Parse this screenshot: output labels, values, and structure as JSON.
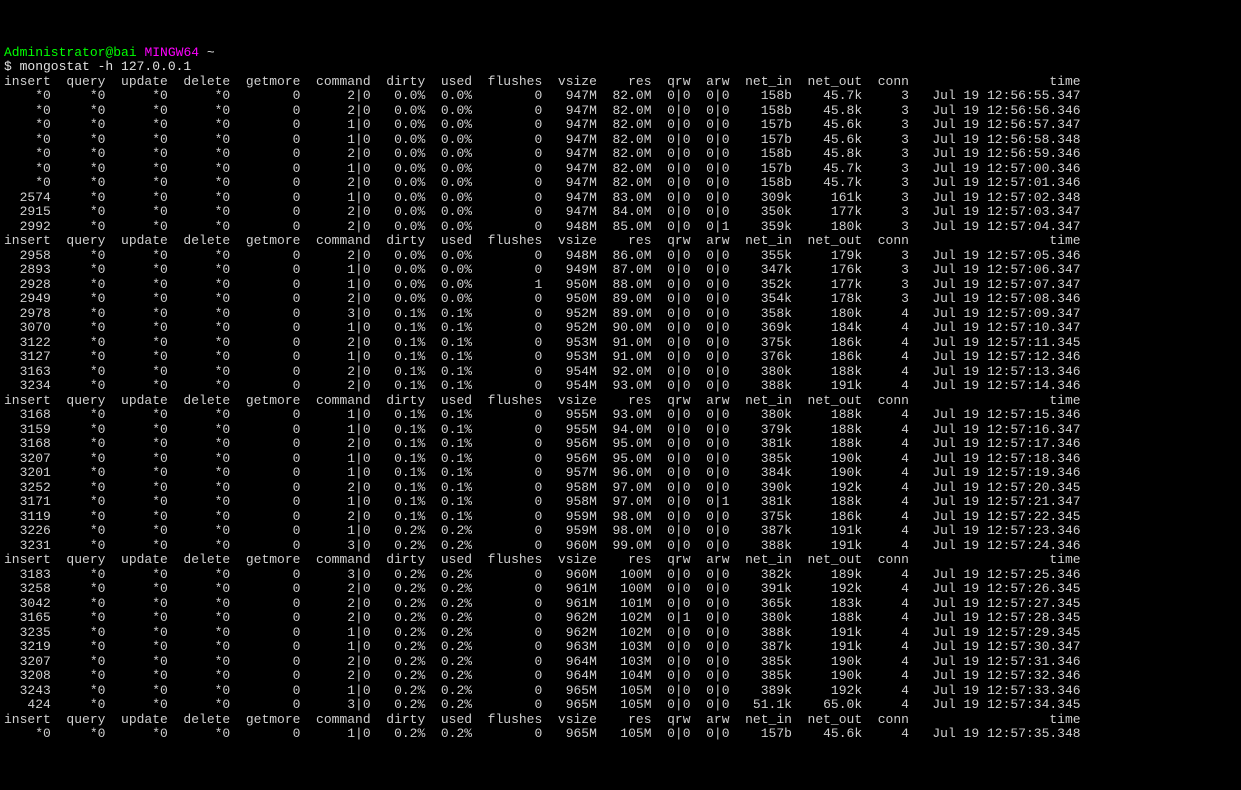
{
  "prompt": {
    "user": "Administrator@bai",
    "sys": "MINGW64",
    "path": "~"
  },
  "command": "$ mongostat -h 127.0.0.1",
  "headers": [
    "insert",
    "query",
    "update",
    "delete",
    "getmore",
    "command",
    "dirty",
    "used",
    "flushes",
    "vsize",
    "res",
    "qrw",
    "arw",
    "net_in",
    "net_out",
    "conn",
    "time"
  ],
  "cw": {
    "insert": 6,
    "query": 6,
    "update": 7,
    "delete": 7,
    "getmore": 8,
    "command": 8,
    "dirty": 6,
    "used": 5,
    "flushes": 8,
    "vsize": 6,
    "res": 6,
    "qrw": 4,
    "arw": 4,
    "net_in": 7,
    "net_out": 8,
    "conn": 5,
    "time": 21
  },
  "blocks": [
    [
      {
        "insert": "*0",
        "query": "*0",
        "update": "*0",
        "delete": "*0",
        "getmore": "0",
        "command": "2|0",
        "dirty": "0.0%",
        "used": "0.0%",
        "flushes": "0",
        "vsize": "947M",
        "res": "82.0M",
        "qrw": "0|0",
        "arw": "0|0",
        "net_in": "158b",
        "net_out": "45.7k",
        "conn": "3",
        "time": "Jul 19 12:56:55.347"
      },
      {
        "insert": "*0",
        "query": "*0",
        "update": "*0",
        "delete": "*0",
        "getmore": "0",
        "command": "2|0",
        "dirty": "0.0%",
        "used": "0.0%",
        "flushes": "0",
        "vsize": "947M",
        "res": "82.0M",
        "qrw": "0|0",
        "arw": "0|0",
        "net_in": "158b",
        "net_out": "45.8k",
        "conn": "3",
        "time": "Jul 19 12:56:56.346"
      },
      {
        "insert": "*0",
        "query": "*0",
        "update": "*0",
        "delete": "*0",
        "getmore": "0",
        "command": "1|0",
        "dirty": "0.0%",
        "used": "0.0%",
        "flushes": "0",
        "vsize": "947M",
        "res": "82.0M",
        "qrw": "0|0",
        "arw": "0|0",
        "net_in": "157b",
        "net_out": "45.6k",
        "conn": "3",
        "time": "Jul 19 12:56:57.347"
      },
      {
        "insert": "*0",
        "query": "*0",
        "update": "*0",
        "delete": "*0",
        "getmore": "0",
        "command": "1|0",
        "dirty": "0.0%",
        "used": "0.0%",
        "flushes": "0",
        "vsize": "947M",
        "res": "82.0M",
        "qrw": "0|0",
        "arw": "0|0",
        "net_in": "157b",
        "net_out": "45.6k",
        "conn": "3",
        "time": "Jul 19 12:56:58.348"
      },
      {
        "insert": "*0",
        "query": "*0",
        "update": "*0",
        "delete": "*0",
        "getmore": "0",
        "command": "2|0",
        "dirty": "0.0%",
        "used": "0.0%",
        "flushes": "0",
        "vsize": "947M",
        "res": "82.0M",
        "qrw": "0|0",
        "arw": "0|0",
        "net_in": "158b",
        "net_out": "45.8k",
        "conn": "3",
        "time": "Jul 19 12:56:59.346"
      },
      {
        "insert": "*0",
        "query": "*0",
        "update": "*0",
        "delete": "*0",
        "getmore": "0",
        "command": "1|0",
        "dirty": "0.0%",
        "used": "0.0%",
        "flushes": "0",
        "vsize": "947M",
        "res": "82.0M",
        "qrw": "0|0",
        "arw": "0|0",
        "net_in": "157b",
        "net_out": "45.7k",
        "conn": "3",
        "time": "Jul 19 12:57:00.346"
      },
      {
        "insert": "*0",
        "query": "*0",
        "update": "*0",
        "delete": "*0",
        "getmore": "0",
        "command": "2|0",
        "dirty": "0.0%",
        "used": "0.0%",
        "flushes": "0",
        "vsize": "947M",
        "res": "82.0M",
        "qrw": "0|0",
        "arw": "0|0",
        "net_in": "158b",
        "net_out": "45.7k",
        "conn": "3",
        "time": "Jul 19 12:57:01.346"
      },
      {
        "insert": "2574",
        "query": "*0",
        "update": "*0",
        "delete": "*0",
        "getmore": "0",
        "command": "1|0",
        "dirty": "0.0%",
        "used": "0.0%",
        "flushes": "0",
        "vsize": "947M",
        "res": "83.0M",
        "qrw": "0|0",
        "arw": "0|0",
        "net_in": "309k",
        "net_out": "161k",
        "conn": "3",
        "time": "Jul 19 12:57:02.348"
      },
      {
        "insert": "2915",
        "query": "*0",
        "update": "*0",
        "delete": "*0",
        "getmore": "0",
        "command": "2|0",
        "dirty": "0.0%",
        "used": "0.0%",
        "flushes": "0",
        "vsize": "947M",
        "res": "84.0M",
        "qrw": "0|0",
        "arw": "0|0",
        "net_in": "350k",
        "net_out": "177k",
        "conn": "3",
        "time": "Jul 19 12:57:03.347"
      },
      {
        "insert": "2992",
        "query": "*0",
        "update": "*0",
        "delete": "*0",
        "getmore": "0",
        "command": "2|0",
        "dirty": "0.0%",
        "used": "0.0%",
        "flushes": "0",
        "vsize": "948M",
        "res": "85.0M",
        "qrw": "0|0",
        "arw": "0|1",
        "net_in": "359k",
        "net_out": "180k",
        "conn": "3",
        "time": "Jul 19 12:57:04.347"
      }
    ],
    [
      {
        "insert": "2958",
        "query": "*0",
        "update": "*0",
        "delete": "*0",
        "getmore": "0",
        "command": "2|0",
        "dirty": "0.0%",
        "used": "0.0%",
        "flushes": "0",
        "vsize": "948M",
        "res": "86.0M",
        "qrw": "0|0",
        "arw": "0|0",
        "net_in": "355k",
        "net_out": "179k",
        "conn": "3",
        "time": "Jul 19 12:57:05.346"
      },
      {
        "insert": "2893",
        "query": "*0",
        "update": "*0",
        "delete": "*0",
        "getmore": "0",
        "command": "1|0",
        "dirty": "0.0%",
        "used": "0.0%",
        "flushes": "0",
        "vsize": "949M",
        "res": "87.0M",
        "qrw": "0|0",
        "arw": "0|0",
        "net_in": "347k",
        "net_out": "176k",
        "conn": "3",
        "time": "Jul 19 12:57:06.347"
      },
      {
        "insert": "2928",
        "query": "*0",
        "update": "*0",
        "delete": "*0",
        "getmore": "0",
        "command": "1|0",
        "dirty": "0.0%",
        "used": "0.0%",
        "flushes": "1",
        "vsize": "950M",
        "res": "88.0M",
        "qrw": "0|0",
        "arw": "0|0",
        "net_in": "352k",
        "net_out": "177k",
        "conn": "3",
        "time": "Jul 19 12:57:07.347"
      },
      {
        "insert": "2949",
        "query": "*0",
        "update": "*0",
        "delete": "*0",
        "getmore": "0",
        "command": "2|0",
        "dirty": "0.0%",
        "used": "0.0%",
        "flushes": "0",
        "vsize": "950M",
        "res": "89.0M",
        "qrw": "0|0",
        "arw": "0|0",
        "net_in": "354k",
        "net_out": "178k",
        "conn": "3",
        "time": "Jul 19 12:57:08.346"
      },
      {
        "insert": "2978",
        "query": "*0",
        "update": "*0",
        "delete": "*0",
        "getmore": "0",
        "command": "3|0",
        "dirty": "0.1%",
        "used": "0.1%",
        "flushes": "0",
        "vsize": "952M",
        "res": "89.0M",
        "qrw": "0|0",
        "arw": "0|0",
        "net_in": "358k",
        "net_out": "180k",
        "conn": "4",
        "time": "Jul 19 12:57:09.347"
      },
      {
        "insert": "3070",
        "query": "*0",
        "update": "*0",
        "delete": "*0",
        "getmore": "0",
        "command": "1|0",
        "dirty": "0.1%",
        "used": "0.1%",
        "flushes": "0",
        "vsize": "952M",
        "res": "90.0M",
        "qrw": "0|0",
        "arw": "0|0",
        "net_in": "369k",
        "net_out": "184k",
        "conn": "4",
        "time": "Jul 19 12:57:10.347"
      },
      {
        "insert": "3122",
        "query": "*0",
        "update": "*0",
        "delete": "*0",
        "getmore": "0",
        "command": "2|0",
        "dirty": "0.1%",
        "used": "0.1%",
        "flushes": "0",
        "vsize": "953M",
        "res": "91.0M",
        "qrw": "0|0",
        "arw": "0|0",
        "net_in": "375k",
        "net_out": "186k",
        "conn": "4",
        "time": "Jul 19 12:57:11.345"
      },
      {
        "insert": "3127",
        "query": "*0",
        "update": "*0",
        "delete": "*0",
        "getmore": "0",
        "command": "1|0",
        "dirty": "0.1%",
        "used": "0.1%",
        "flushes": "0",
        "vsize": "953M",
        "res": "91.0M",
        "qrw": "0|0",
        "arw": "0|0",
        "net_in": "376k",
        "net_out": "186k",
        "conn": "4",
        "time": "Jul 19 12:57:12.346"
      },
      {
        "insert": "3163",
        "query": "*0",
        "update": "*0",
        "delete": "*0",
        "getmore": "0",
        "command": "2|0",
        "dirty": "0.1%",
        "used": "0.1%",
        "flushes": "0",
        "vsize": "954M",
        "res": "92.0M",
        "qrw": "0|0",
        "arw": "0|0",
        "net_in": "380k",
        "net_out": "188k",
        "conn": "4",
        "time": "Jul 19 12:57:13.346"
      },
      {
        "insert": "3234",
        "query": "*0",
        "update": "*0",
        "delete": "*0",
        "getmore": "0",
        "command": "2|0",
        "dirty": "0.1%",
        "used": "0.1%",
        "flushes": "0",
        "vsize": "954M",
        "res": "93.0M",
        "qrw": "0|0",
        "arw": "0|0",
        "net_in": "388k",
        "net_out": "191k",
        "conn": "4",
        "time": "Jul 19 12:57:14.346"
      }
    ],
    [
      {
        "insert": "3168",
        "query": "*0",
        "update": "*0",
        "delete": "*0",
        "getmore": "0",
        "command": "1|0",
        "dirty": "0.1%",
        "used": "0.1%",
        "flushes": "0",
        "vsize": "955M",
        "res": "93.0M",
        "qrw": "0|0",
        "arw": "0|0",
        "net_in": "380k",
        "net_out": "188k",
        "conn": "4",
        "time": "Jul 19 12:57:15.346"
      },
      {
        "insert": "3159",
        "query": "*0",
        "update": "*0",
        "delete": "*0",
        "getmore": "0",
        "command": "1|0",
        "dirty": "0.1%",
        "used": "0.1%",
        "flushes": "0",
        "vsize": "955M",
        "res": "94.0M",
        "qrw": "0|0",
        "arw": "0|0",
        "net_in": "379k",
        "net_out": "188k",
        "conn": "4",
        "time": "Jul 19 12:57:16.347"
      },
      {
        "insert": "3168",
        "query": "*0",
        "update": "*0",
        "delete": "*0",
        "getmore": "0",
        "command": "2|0",
        "dirty": "0.1%",
        "used": "0.1%",
        "flushes": "0",
        "vsize": "956M",
        "res": "95.0M",
        "qrw": "0|0",
        "arw": "0|0",
        "net_in": "381k",
        "net_out": "188k",
        "conn": "4",
        "time": "Jul 19 12:57:17.346"
      },
      {
        "insert": "3207",
        "query": "*0",
        "update": "*0",
        "delete": "*0",
        "getmore": "0",
        "command": "1|0",
        "dirty": "0.1%",
        "used": "0.1%",
        "flushes": "0",
        "vsize": "956M",
        "res": "95.0M",
        "qrw": "0|0",
        "arw": "0|0",
        "net_in": "385k",
        "net_out": "190k",
        "conn": "4",
        "time": "Jul 19 12:57:18.346"
      },
      {
        "insert": "3201",
        "query": "*0",
        "update": "*0",
        "delete": "*0",
        "getmore": "0",
        "command": "1|0",
        "dirty": "0.1%",
        "used": "0.1%",
        "flushes": "0",
        "vsize": "957M",
        "res": "96.0M",
        "qrw": "0|0",
        "arw": "0|0",
        "net_in": "384k",
        "net_out": "190k",
        "conn": "4",
        "time": "Jul 19 12:57:19.346"
      },
      {
        "insert": "3252",
        "query": "*0",
        "update": "*0",
        "delete": "*0",
        "getmore": "0",
        "command": "2|0",
        "dirty": "0.1%",
        "used": "0.1%",
        "flushes": "0",
        "vsize": "958M",
        "res": "97.0M",
        "qrw": "0|0",
        "arw": "0|0",
        "net_in": "390k",
        "net_out": "192k",
        "conn": "4",
        "time": "Jul 19 12:57:20.345"
      },
      {
        "insert": "3171",
        "query": "*0",
        "update": "*0",
        "delete": "*0",
        "getmore": "0",
        "command": "1|0",
        "dirty": "0.1%",
        "used": "0.1%",
        "flushes": "0",
        "vsize": "958M",
        "res": "97.0M",
        "qrw": "0|0",
        "arw": "0|1",
        "net_in": "381k",
        "net_out": "188k",
        "conn": "4",
        "time": "Jul 19 12:57:21.347"
      },
      {
        "insert": "3119",
        "query": "*0",
        "update": "*0",
        "delete": "*0",
        "getmore": "0",
        "command": "2|0",
        "dirty": "0.1%",
        "used": "0.1%",
        "flushes": "0",
        "vsize": "959M",
        "res": "98.0M",
        "qrw": "0|0",
        "arw": "0|0",
        "net_in": "375k",
        "net_out": "186k",
        "conn": "4",
        "time": "Jul 19 12:57:22.345"
      },
      {
        "insert": "3226",
        "query": "*0",
        "update": "*0",
        "delete": "*0",
        "getmore": "0",
        "command": "1|0",
        "dirty": "0.2%",
        "used": "0.2%",
        "flushes": "0",
        "vsize": "959M",
        "res": "98.0M",
        "qrw": "0|0",
        "arw": "0|0",
        "net_in": "387k",
        "net_out": "191k",
        "conn": "4",
        "time": "Jul 19 12:57:23.346"
      },
      {
        "insert": "3231",
        "query": "*0",
        "update": "*0",
        "delete": "*0",
        "getmore": "0",
        "command": "3|0",
        "dirty": "0.2%",
        "used": "0.2%",
        "flushes": "0",
        "vsize": "960M",
        "res": "99.0M",
        "qrw": "0|0",
        "arw": "0|0",
        "net_in": "388k",
        "net_out": "191k",
        "conn": "4",
        "time": "Jul 19 12:57:24.346"
      }
    ],
    [
      {
        "insert": "3183",
        "query": "*0",
        "update": "*0",
        "delete": "*0",
        "getmore": "0",
        "command": "3|0",
        "dirty": "0.2%",
        "used": "0.2%",
        "flushes": "0",
        "vsize": "960M",
        "res": "100M",
        "qrw": "0|0",
        "arw": "0|0",
        "net_in": "382k",
        "net_out": "189k",
        "conn": "4",
        "time": "Jul 19 12:57:25.346"
      },
      {
        "insert": "3258",
        "query": "*0",
        "update": "*0",
        "delete": "*0",
        "getmore": "0",
        "command": "2|0",
        "dirty": "0.2%",
        "used": "0.2%",
        "flushes": "0",
        "vsize": "961M",
        "res": "100M",
        "qrw": "0|0",
        "arw": "0|0",
        "net_in": "391k",
        "net_out": "192k",
        "conn": "4",
        "time": "Jul 19 12:57:26.345"
      },
      {
        "insert": "3042",
        "query": "*0",
        "update": "*0",
        "delete": "*0",
        "getmore": "0",
        "command": "2|0",
        "dirty": "0.2%",
        "used": "0.2%",
        "flushes": "0",
        "vsize": "961M",
        "res": "101M",
        "qrw": "0|0",
        "arw": "0|0",
        "net_in": "365k",
        "net_out": "183k",
        "conn": "4",
        "time": "Jul 19 12:57:27.345"
      },
      {
        "insert": "3165",
        "query": "*0",
        "update": "*0",
        "delete": "*0",
        "getmore": "0",
        "command": "2|0",
        "dirty": "0.2%",
        "used": "0.2%",
        "flushes": "0",
        "vsize": "962M",
        "res": "102M",
        "qrw": "0|1",
        "arw": "0|0",
        "net_in": "380k",
        "net_out": "188k",
        "conn": "4",
        "time": "Jul 19 12:57:28.345"
      },
      {
        "insert": "3235",
        "query": "*0",
        "update": "*0",
        "delete": "*0",
        "getmore": "0",
        "command": "1|0",
        "dirty": "0.2%",
        "used": "0.2%",
        "flushes": "0",
        "vsize": "962M",
        "res": "102M",
        "qrw": "0|0",
        "arw": "0|0",
        "net_in": "388k",
        "net_out": "191k",
        "conn": "4",
        "time": "Jul 19 12:57:29.345"
      },
      {
        "insert": "3219",
        "query": "*0",
        "update": "*0",
        "delete": "*0",
        "getmore": "0",
        "command": "1|0",
        "dirty": "0.2%",
        "used": "0.2%",
        "flushes": "0",
        "vsize": "963M",
        "res": "103M",
        "qrw": "0|0",
        "arw": "0|0",
        "net_in": "387k",
        "net_out": "191k",
        "conn": "4",
        "time": "Jul 19 12:57:30.347"
      },
      {
        "insert": "3207",
        "query": "*0",
        "update": "*0",
        "delete": "*0",
        "getmore": "0",
        "command": "2|0",
        "dirty": "0.2%",
        "used": "0.2%",
        "flushes": "0",
        "vsize": "964M",
        "res": "103M",
        "qrw": "0|0",
        "arw": "0|0",
        "net_in": "385k",
        "net_out": "190k",
        "conn": "4",
        "time": "Jul 19 12:57:31.346"
      },
      {
        "insert": "3208",
        "query": "*0",
        "update": "*0",
        "delete": "*0",
        "getmore": "0",
        "command": "2|0",
        "dirty": "0.2%",
        "used": "0.2%",
        "flushes": "0",
        "vsize": "964M",
        "res": "104M",
        "qrw": "0|0",
        "arw": "0|0",
        "net_in": "385k",
        "net_out": "190k",
        "conn": "4",
        "time": "Jul 19 12:57:32.346"
      },
      {
        "insert": "3243",
        "query": "*0",
        "update": "*0",
        "delete": "*0",
        "getmore": "0",
        "command": "1|0",
        "dirty": "0.2%",
        "used": "0.2%",
        "flushes": "0",
        "vsize": "965M",
        "res": "105M",
        "qrw": "0|0",
        "arw": "0|0",
        "net_in": "389k",
        "net_out": "192k",
        "conn": "4",
        "time": "Jul 19 12:57:33.346"
      },
      {
        "insert": "424",
        "query": "*0",
        "update": "*0",
        "delete": "*0",
        "getmore": "0",
        "command": "3|0",
        "dirty": "0.2%",
        "used": "0.2%",
        "flushes": "0",
        "vsize": "965M",
        "res": "105M",
        "qrw": "0|0",
        "arw": "0|0",
        "net_in": "51.1k",
        "net_out": "65.0k",
        "conn": "4",
        "time": "Jul 19 12:57:34.345"
      }
    ],
    [
      {
        "insert": "*0",
        "query": "*0",
        "update": "*0",
        "delete": "*0",
        "getmore": "0",
        "command": "1|0",
        "dirty": "0.2%",
        "used": "0.2%",
        "flushes": "0",
        "vsize": "965M",
        "res": "105M",
        "qrw": "0|0",
        "arw": "0|0",
        "net_in": "157b",
        "net_out": "45.6k",
        "conn": "4",
        "time": "Jul 19 12:57:35.348"
      }
    ]
  ]
}
